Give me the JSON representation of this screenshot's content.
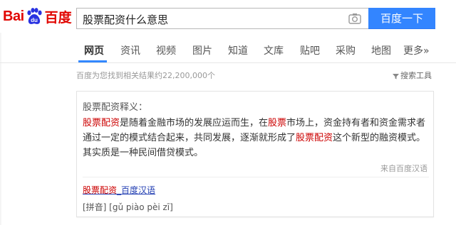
{
  "logo": {
    "bai": "Bai",
    "du": "du",
    "cn": "百度"
  },
  "search": {
    "query": "股票配资什么意思",
    "button_label": "百度一下"
  },
  "nav": {
    "items": [
      "网页",
      "资讯",
      "视频",
      "图片",
      "知道",
      "文库",
      "贴吧",
      "采购",
      "地图",
      "更多»"
    ],
    "active": "网页"
  },
  "results": {
    "stats": "百度为您找到相关结果约22,200,000个",
    "tools_label": "搜索工具"
  },
  "card": {
    "title": "股票配资释义：",
    "body_parts": [
      {
        "text": "股票配资",
        "hl": true
      },
      {
        "text": "是随着金融市场的发展应运而生，在",
        "hl": false
      },
      {
        "text": "股票",
        "hl": true
      },
      {
        "text": "市场上，资金持有者和资金需求者通过一定的模式结合起来，共同发展，逐渐就形成了",
        "hl": false
      },
      {
        "text": "股票配资",
        "hl": true
      },
      {
        "text": "这个新型的融资模式。其实质是一种民间借贷模式。",
        "hl": false
      }
    ],
    "source": "来自百度汉语",
    "link_hl": "股票配资",
    "link_rest": "_百度汉语",
    "pinyin": "[拼音] [gǔ piào pèi zī]"
  },
  "colors": {
    "brand_red": "#e10601",
    "brand_blue": "#2932e1",
    "button_blue": "#3385ff",
    "highlight": "#cc0000",
    "link": "#2440b3"
  }
}
